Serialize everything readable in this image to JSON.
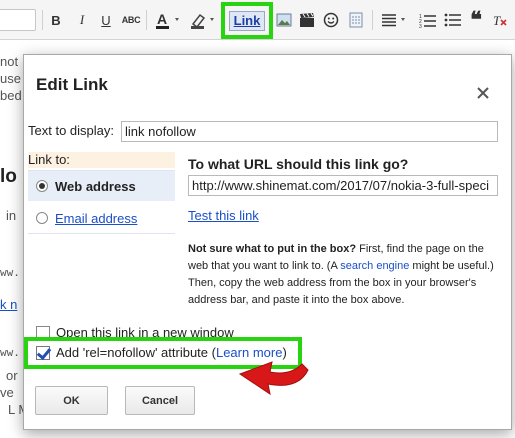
{
  "toolbar": {
    "bold": "B",
    "italic": "I",
    "underline": "U",
    "strikethrough": "ABC",
    "link": "Link",
    "quote": "❝"
  },
  "background": {
    "lines": [
      "not",
      "use",
      "bed",
      "lo",
      "in",
      "ww.",
      "k n",
      "ww.",
      "or",
      "ve",
      "L  M"
    ]
  },
  "dialog": {
    "title": "Edit Link",
    "text_to_display_label": "Text to display:",
    "text_to_display_value": "link nofollow",
    "link_to_label": "Link to:",
    "options": [
      {
        "label": "Web address",
        "selected": true
      },
      {
        "label": "Email address",
        "selected": false
      }
    ],
    "url_question": "To what URL should this link go?",
    "url_value": "http://www.shinemat.com/2017/07/nokia-3-full-speci",
    "test_link": "Test this link",
    "help": {
      "bold": "Not sure what to put in the box?",
      "part1": " First, find the page on the web that you want to link to. (A ",
      "link": "search engine",
      "part2": " might be useful.) Then, copy the web address from the box in your browser's address bar, and paste it into the box above."
    },
    "new_window_label": "Open this link in a new window",
    "new_window_checked": false,
    "nofollow_label": "Add 'rel=nofollow' attribute (",
    "nofollow_link": "Learn more",
    "nofollow_close": ")",
    "nofollow_checked": true,
    "ok_label": "OK",
    "cancel_label": "Cancel"
  },
  "colors": {
    "highlight_green": "#28d40f",
    "arrow_red": "#d81818",
    "link_blue": "#1a4fc8"
  }
}
